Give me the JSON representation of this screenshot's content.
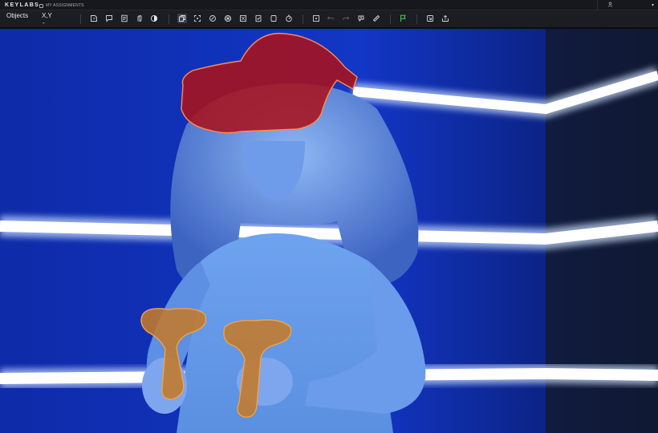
{
  "app": {
    "brand": "KEYLABS",
    "nav_link": "MY ASSIGNMENTS",
    "user_menu_label": "",
    "user_icon": "user-icon"
  },
  "toolbar": {
    "objects_label": "Objects",
    "xy_label": "X,Y",
    "xy_value": "-",
    "tools": [
      {
        "name": "polygon-tool-icon"
      },
      {
        "name": "comment-tool-icon"
      },
      {
        "name": "document-tool-icon"
      },
      {
        "name": "hand-tool-icon"
      },
      {
        "name": "contrast-icon"
      },
      {
        "name": "copy-icon",
        "active": true
      },
      {
        "name": "fit-screen-icon"
      },
      {
        "name": "brush-icon"
      },
      {
        "name": "grid-icon"
      },
      {
        "name": "layers-icon"
      },
      {
        "name": "frame-icon"
      },
      {
        "name": "timer-icon"
      },
      {
        "name": "add-point-icon"
      },
      {
        "name": "undo-icon",
        "disabled": true
      },
      {
        "name": "redo-icon",
        "disabled": true
      },
      {
        "name": "zoom-icon"
      },
      {
        "name": "ruler-icon"
      },
      {
        "name": "flag-icon",
        "color": "#3cd35a"
      },
      {
        "name": "export-icon"
      },
      {
        "name": "share-icon"
      }
    ]
  },
  "annotations": [
    {
      "label": "VR headset",
      "color": "#c8232e"
    },
    {
      "label": "Controller",
      "color": "#e0892a"
    },
    {
      "label": "Controller",
      "color": "#e0892a"
    }
  ],
  "colors": {
    "topbar_bg": "#16181d",
    "toolbar_bg": "#1b1d22",
    "background_wall": "#0f2fb4",
    "headset_mask": "#a8121c",
    "controller_mask": "#c47a2a",
    "flag_green": "#3cd35a"
  }
}
